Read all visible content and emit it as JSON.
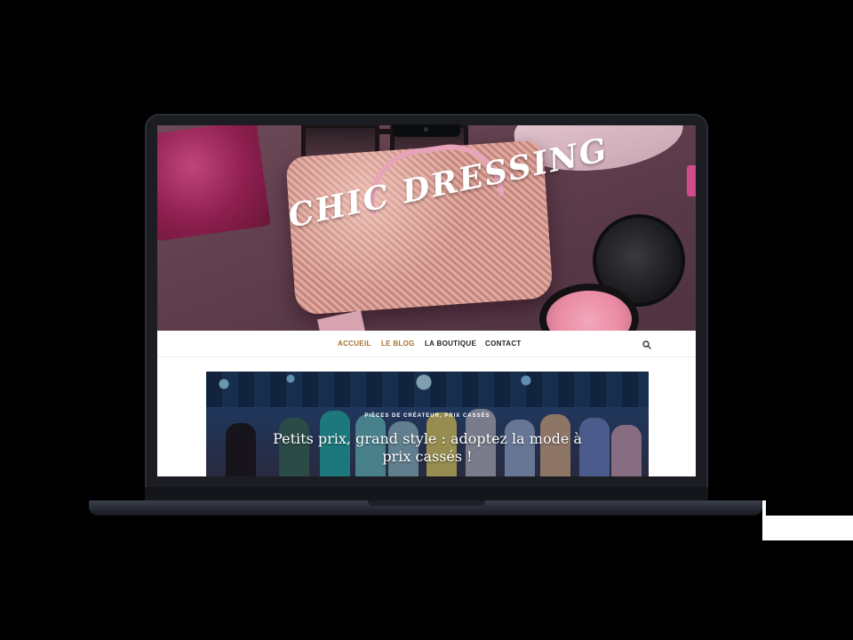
{
  "site": {
    "title": "CHIC DRESSING"
  },
  "nav": {
    "items": [
      {
        "label": "ACCUEIL",
        "active": true
      },
      {
        "label": "LE BLOG",
        "active": true
      },
      {
        "label": "LA BOUTIQUE",
        "active": false
      },
      {
        "label": "CONTACT",
        "active": false
      }
    ],
    "search_icon": "search-icon"
  },
  "featured": {
    "category": "PIÈCES DE CRÉATEUR, PRIX CASSÉS",
    "title": "Petits prix, grand style : adoptez la mode à prix cassés !"
  },
  "colors": {
    "nav_active": "#a5722c",
    "nav_text": "#222222",
    "hero_bg": "#5c3b4a",
    "laptop_body": "#1b1d22"
  }
}
